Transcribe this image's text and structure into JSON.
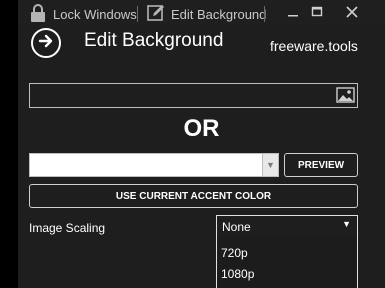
{
  "titlebar": {
    "lock_label": "Lock Windows",
    "edit_label": "Edit Background",
    "minimize_icon": "minimize-icon",
    "maximize_icon": "maximize-icon",
    "close_icon": "close-icon"
  },
  "header": {
    "title": "Edit Background",
    "brand": "freeware.tools"
  },
  "image_path": {
    "value": "",
    "browse_icon": "image-icon"
  },
  "or_text": "OR",
  "color": {
    "value": "#ffffff"
  },
  "preview_label": "PREVIEW",
  "accent_label": "USE CURRENT ACCENT COLOR",
  "scaling": {
    "label": "Image Scaling",
    "selected": "None",
    "options": [
      "720p",
      "1080p"
    ]
  },
  "colors": {
    "background": "#1e1e1e",
    "text": "#ffffff",
    "border": "#cfcfcf"
  }
}
